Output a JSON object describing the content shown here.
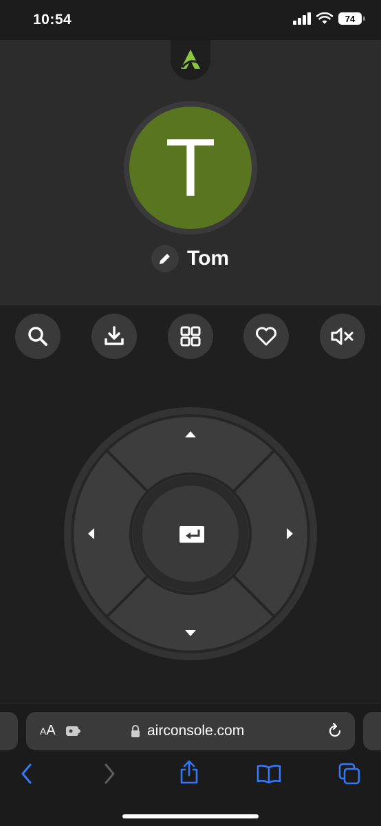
{
  "status_bar": {
    "time": "10:54",
    "battery": "74"
  },
  "profile": {
    "initial": "T",
    "name": "Tom",
    "avatar_color": "#5a7520"
  },
  "toolbar": {
    "buttons": [
      {
        "icon": "search-icon"
      },
      {
        "icon": "download-icon"
      },
      {
        "icon": "grid-icon"
      },
      {
        "icon": "heart-icon"
      },
      {
        "icon": "mute-icon"
      }
    ]
  },
  "dpad": {
    "center_icon": "enter-icon"
  },
  "browser": {
    "url": "airconsole.com",
    "text_size": "AA"
  },
  "colors": {
    "accent": "#8cc63f",
    "ios_blue": "#3478f6"
  }
}
